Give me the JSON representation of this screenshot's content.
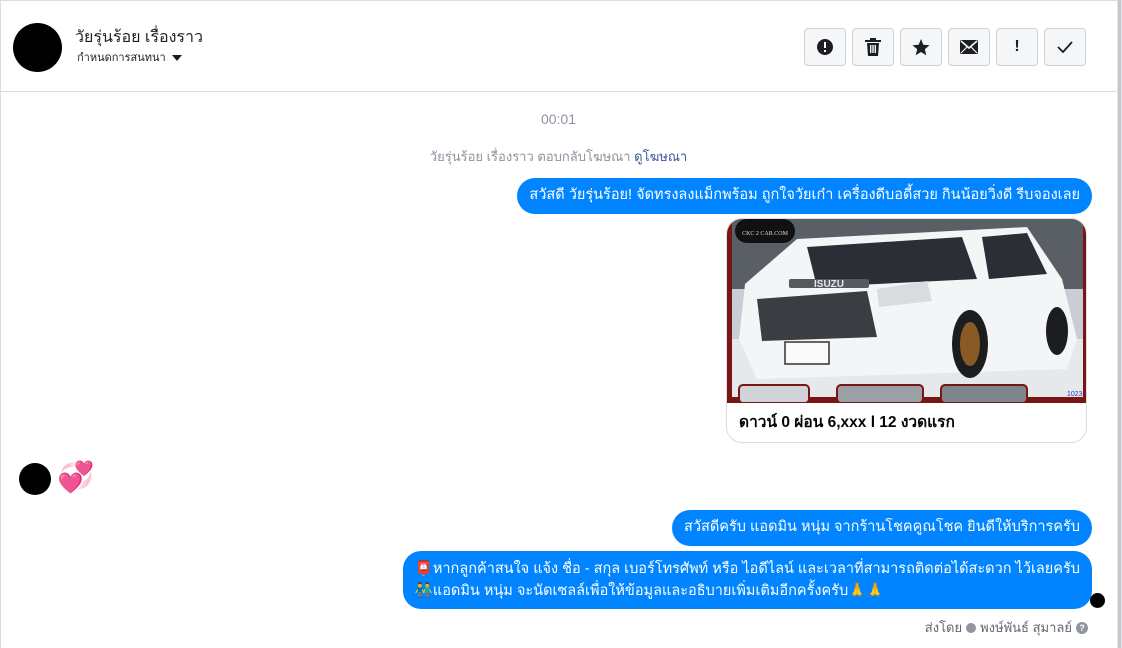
{
  "header": {
    "contact_name": "วัยรุ่นร้อย เรื่องราว",
    "conversation_setting": "กำหนดการสนทนา"
  },
  "toolbar": {
    "buttons": [
      {
        "icon": "alert-circle-icon"
      },
      {
        "icon": "trash-icon"
      },
      {
        "icon": "star-icon"
      },
      {
        "icon": "envelope-icon"
      },
      {
        "icon": "exclamation-icon",
        "label": "!"
      },
      {
        "icon": "checkmark-icon"
      }
    ]
  },
  "thread": {
    "timestamp": "00:01",
    "ad_reply_note": "วัยรุ่นร้อย เรื่องราว ตอบกลับโฆษณา",
    "ad_link": "ดูโฆษณา",
    "msg_ad": "สวัสดี วัยรุ่นร้อย! จัดทรงลงแม็กพร้อม ถูกใจวัยเก๋า เครื่องดีบอดี้สวย กินน้อยวิ่งดี รีบจองเลย",
    "card_caption": "ดาวน์ 0 ผ่อน 6,xxx l 12 งวดแรก",
    "card_image_text": {
      "watermark": "CKC 2 CAR.COM",
      "brand": "ISUZU",
      "tag": "1023"
    },
    "reaction": "💞",
    "msg_greet": "สวัสดีครับ แอดมิน หนุ่ม จากร้านโชคคูณโชค ยินดีให้บริการครับ",
    "msg_info_line1": "📮หากลูกค้าสนใจ แจ้ง ชื่อ - สกุล เบอร์โทรศัพท์ หรือ ไอดีไลน์ และเวลาที่สามารถติดต่อได้สะดวก ไว้เลยครับ",
    "msg_info_line2": "👬แอดมิน หนุ่ม จะนัดเซลล์เพื่อให้ข้อมูลและอธิบายเพิ่มเติมอีกครั้งครับ🙏🙏",
    "sent_by_label": "ส่งโดย",
    "sent_by_name": "พงษ์พันธ์ สุมาลย์",
    "help": "?"
  },
  "colors": {
    "accent": "#0084ff",
    "muted": "#8d949e",
    "link": "#385898"
  }
}
